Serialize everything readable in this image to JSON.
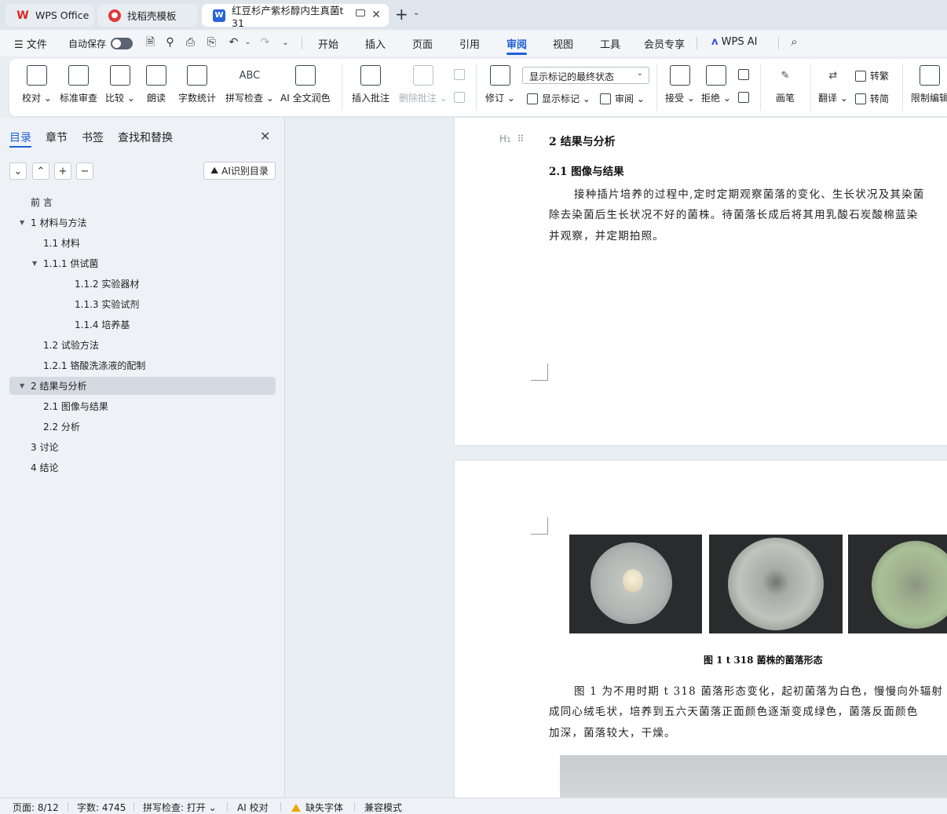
{
  "tabs": [
    {
      "label": "WPS Office",
      "icon": "wps-logo-icon"
    },
    {
      "label": "找稻壳模板",
      "icon": "docer-icon"
    },
    {
      "label": "红豆杉产紫杉醇内生真菌t 31",
      "icon": "word-doc-icon"
    }
  ],
  "menu": {
    "file": "文件",
    "autosave": "自动保存",
    "items": [
      "开始",
      "插入",
      "页面",
      "引用",
      "审阅",
      "视图",
      "工具",
      "会员专享"
    ],
    "active": "审阅",
    "wps_ai": "WPS AI"
  },
  "ribbon": {
    "proofread": "校对",
    "std_review": "标准审查",
    "compare": "比较",
    "read_aloud": "朗读",
    "word_count": "字数统计",
    "spell_check": "拼写检查",
    "ai_polish": "AI 全文润色",
    "insert_comment": "插入批注",
    "delete_comment": "删除批注",
    "track": "修订",
    "markup_state": "显示标记的最终状态",
    "show_markup": "显示标记",
    "review": "审阅",
    "accept": "接受",
    "reject": "拒绝",
    "pen": "画笔",
    "translate": "翻译",
    "to_trad": "转繁",
    "to_simp": "转简",
    "restrict": "限制编辑"
  },
  "panel": {
    "tabs": [
      "目录",
      "章节",
      "书签",
      "查找和替换"
    ],
    "ai_toc": "AI识别目录",
    "toc": [
      {
        "label": "前  言",
        "level": 0
      },
      {
        "label": "1  材料与方法",
        "level": 0,
        "expanded": true
      },
      {
        "label": "1.1  材料",
        "level": 1
      },
      {
        "label": "1.1.1  供试菌",
        "level": 1,
        "expanded": true
      },
      {
        "label": "1.1.2  实验器材",
        "level": 2
      },
      {
        "label": "1.1.3  实验试剂",
        "level": 2
      },
      {
        "label": "1.1.4  培养基",
        "level": 2
      },
      {
        "label": "1.2  试验方法",
        "level": 1
      },
      {
        "label": "1.2.1  铬酸洗涤液的配制",
        "level": 1
      },
      {
        "label": "2  结果与分析",
        "level": 0,
        "expanded": true,
        "selected": true
      },
      {
        "label": "2.1  图像与结果",
        "level": 1
      },
      {
        "label": "2.2  分析",
        "level": 1
      },
      {
        "label": "3  讨论",
        "level": 0
      },
      {
        "label": "4  结论",
        "level": 0
      }
    ]
  },
  "doc": {
    "hmark": "H",
    "heading1": "2  结果与分析",
    "heading2": "2.1  图像与结果",
    "para1": [
      "接种插片培养的过程中,定时定期观察菌落的变化、生长状况及其染菌",
      "除去染菌后生长状况不好的菌株。待菌落长成后将其用乳酸石炭酸棉蓝染",
      "并观察，并定期拍照。"
    ],
    "caption": "图 1    t 318 菌株的菌落形态",
    "para2": [
      "图 1 为不用时期 t 318 菌落形态变化，起初菌落为白色，慢慢向外辐射",
      "成同心绒毛状，培养到五六天菌落正面颜色逐渐变成绿色，菌落反面颜色",
      "加深，菌落较大，干燥。"
    ]
  },
  "status": {
    "page": "页面: 8/12",
    "words": "字数: 4745",
    "spell": "拼写检查: 打开",
    "ai": "AI 校对",
    "missing_font": "缺失字体",
    "compat": "兼容模式"
  },
  "colors": {
    "accent": "#1f5fd8",
    "warning": "#f0a500"
  }
}
